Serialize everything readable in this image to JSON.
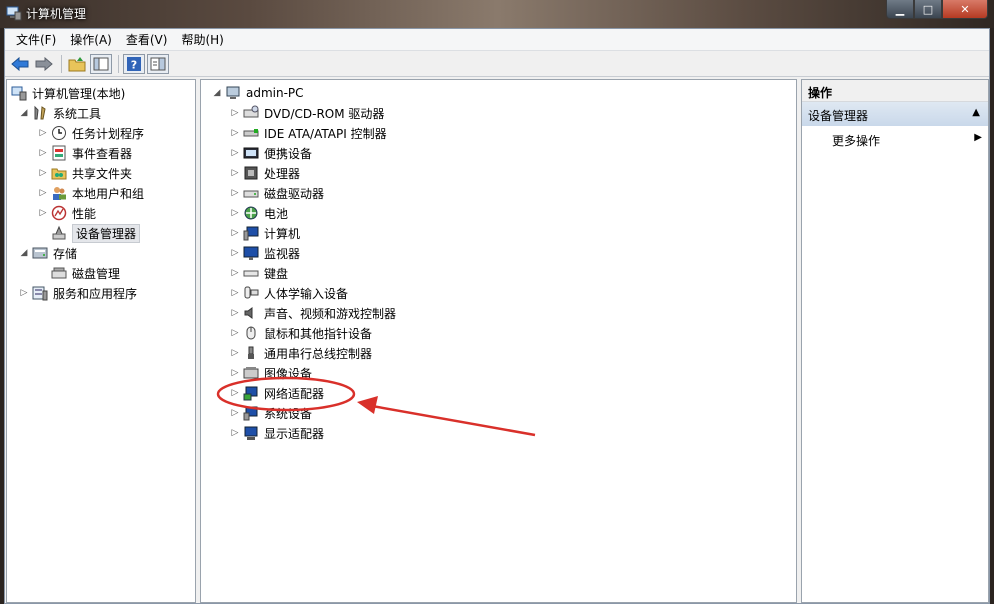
{
  "window": {
    "title": "计算机管理"
  },
  "menu": [
    "文件(F)",
    "操作(A)",
    "查看(V)",
    "帮助(H)"
  ],
  "toolbar": [
    "back-icon",
    "forward-icon",
    "up-folder-icon",
    "show-hide-tree-icon",
    "help-icon",
    "properties-icon"
  ],
  "left_tree": [
    {
      "label": "计算机管理(本地)",
      "icon": "computer-management-icon",
      "expander": "",
      "level": 0
    },
    {
      "label": "系统工具",
      "icon": "system-tools-icon",
      "expander": "expanded",
      "level": 1
    },
    {
      "label": "任务计划程序",
      "icon": "task-scheduler-icon",
      "expander": "collapsed",
      "level": 2
    },
    {
      "label": "事件查看器",
      "icon": "event-viewer-icon",
      "expander": "collapsed",
      "level": 2
    },
    {
      "label": "共享文件夹",
      "icon": "shared-folders-icon",
      "expander": "collapsed",
      "level": 2
    },
    {
      "label": "本地用户和组",
      "icon": "local-users-icon",
      "expander": "collapsed",
      "level": 2
    },
    {
      "label": "性能",
      "icon": "performance-icon",
      "expander": "collapsed",
      "level": 2
    },
    {
      "label": "设备管理器",
      "icon": "device-manager-icon",
      "expander": "",
      "level": 2,
      "selected": true
    },
    {
      "label": "存储",
      "icon": "storage-icon",
      "expander": "expanded",
      "level": 1
    },
    {
      "label": "磁盘管理",
      "icon": "disk-management-icon",
      "expander": "",
      "level": 2
    },
    {
      "label": "服务和应用程序",
      "icon": "services-icon",
      "expander": "collapsed",
      "level": 1
    }
  ],
  "device_tree": {
    "root": "admin-PC",
    "items": [
      {
        "label": "DVD/CD-ROM 驱动器",
        "icon": "dvd-drive-icon"
      },
      {
        "label": "IDE ATA/ATAPI 控制器",
        "icon": "ide-controller-icon"
      },
      {
        "label": "便携设备",
        "icon": "portable-device-icon"
      },
      {
        "label": "处理器",
        "icon": "processor-icon"
      },
      {
        "label": "磁盘驱动器",
        "icon": "disk-drive-icon"
      },
      {
        "label": "电池",
        "icon": "battery-icon"
      },
      {
        "label": "计算机",
        "icon": "computer-icon"
      },
      {
        "label": "监视器",
        "icon": "monitor-icon"
      },
      {
        "label": "键盘",
        "icon": "keyboard-icon"
      },
      {
        "label": "人体学输入设备",
        "icon": "hid-icon"
      },
      {
        "label": "声音、视频和游戏控制器",
        "icon": "sound-icon"
      },
      {
        "label": "鼠标和其他指针设备",
        "icon": "mouse-icon"
      },
      {
        "label": "通用串行总线控制器",
        "icon": "usb-icon"
      },
      {
        "label": "图像设备",
        "icon": "imaging-device-icon"
      },
      {
        "label": "网络适配器",
        "icon": "network-adapter-icon"
      },
      {
        "label": "系统设备",
        "icon": "system-device-icon"
      },
      {
        "label": "显示适配器",
        "icon": "display-adapter-icon"
      }
    ]
  },
  "actions": {
    "header": "操作",
    "section": "设备管理器",
    "more": "更多操作"
  },
  "colors": {
    "annotation": "#d9302a",
    "selection_bg": "#e4e6ea",
    "actions_section": "#c9d8ea"
  }
}
